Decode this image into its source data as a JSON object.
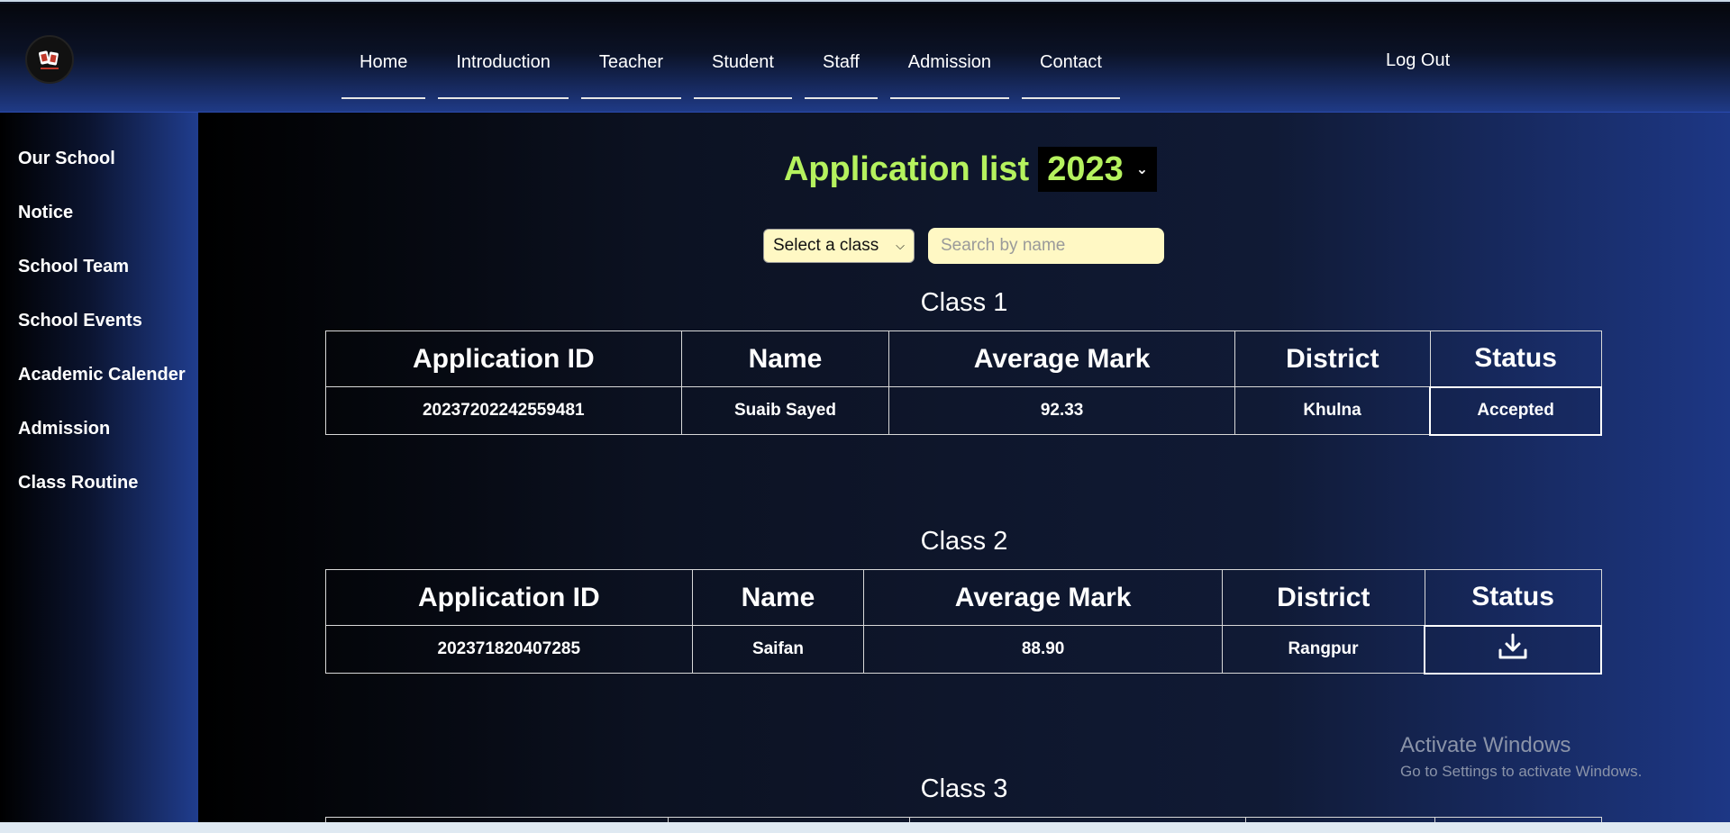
{
  "header": {
    "nav": [
      "Home",
      "Introduction",
      "Teacher",
      "Student",
      "Staff",
      "Admission",
      "Contact"
    ],
    "logout": "Log Out"
  },
  "sidebar": {
    "items": [
      "Our School",
      "Notice",
      "School Team",
      "School Events",
      "Academic Calender",
      "Admission",
      "Class Routine"
    ]
  },
  "main": {
    "title": "Application list",
    "year": "2023",
    "class_select_value": "Select a class",
    "search_placeholder": "Search by name",
    "columns": [
      "Application ID",
      "Name",
      "Average Mark",
      "District",
      "Status"
    ],
    "classes": [
      {
        "heading": "Class 1",
        "rows": [
          {
            "id": "20237202242559481",
            "name": "Suaib Sayed",
            "mark": "92.33",
            "district": "Khulna",
            "status": "Accepted"
          }
        ]
      },
      {
        "heading": "Class 2",
        "rows": [
          {
            "id": "202371820407285",
            "name": "Saifan",
            "mark": "88.90",
            "district": "Rangpur",
            "status_icon": "download-icon"
          }
        ]
      },
      {
        "heading": "Class 3"
      }
    ]
  },
  "watermark": {
    "title": "Activate Windows",
    "subtitle": "Go to Settings to activate Windows."
  },
  "colors": {
    "title": "#b5f25e",
    "input_bg": "#fff8c4"
  }
}
